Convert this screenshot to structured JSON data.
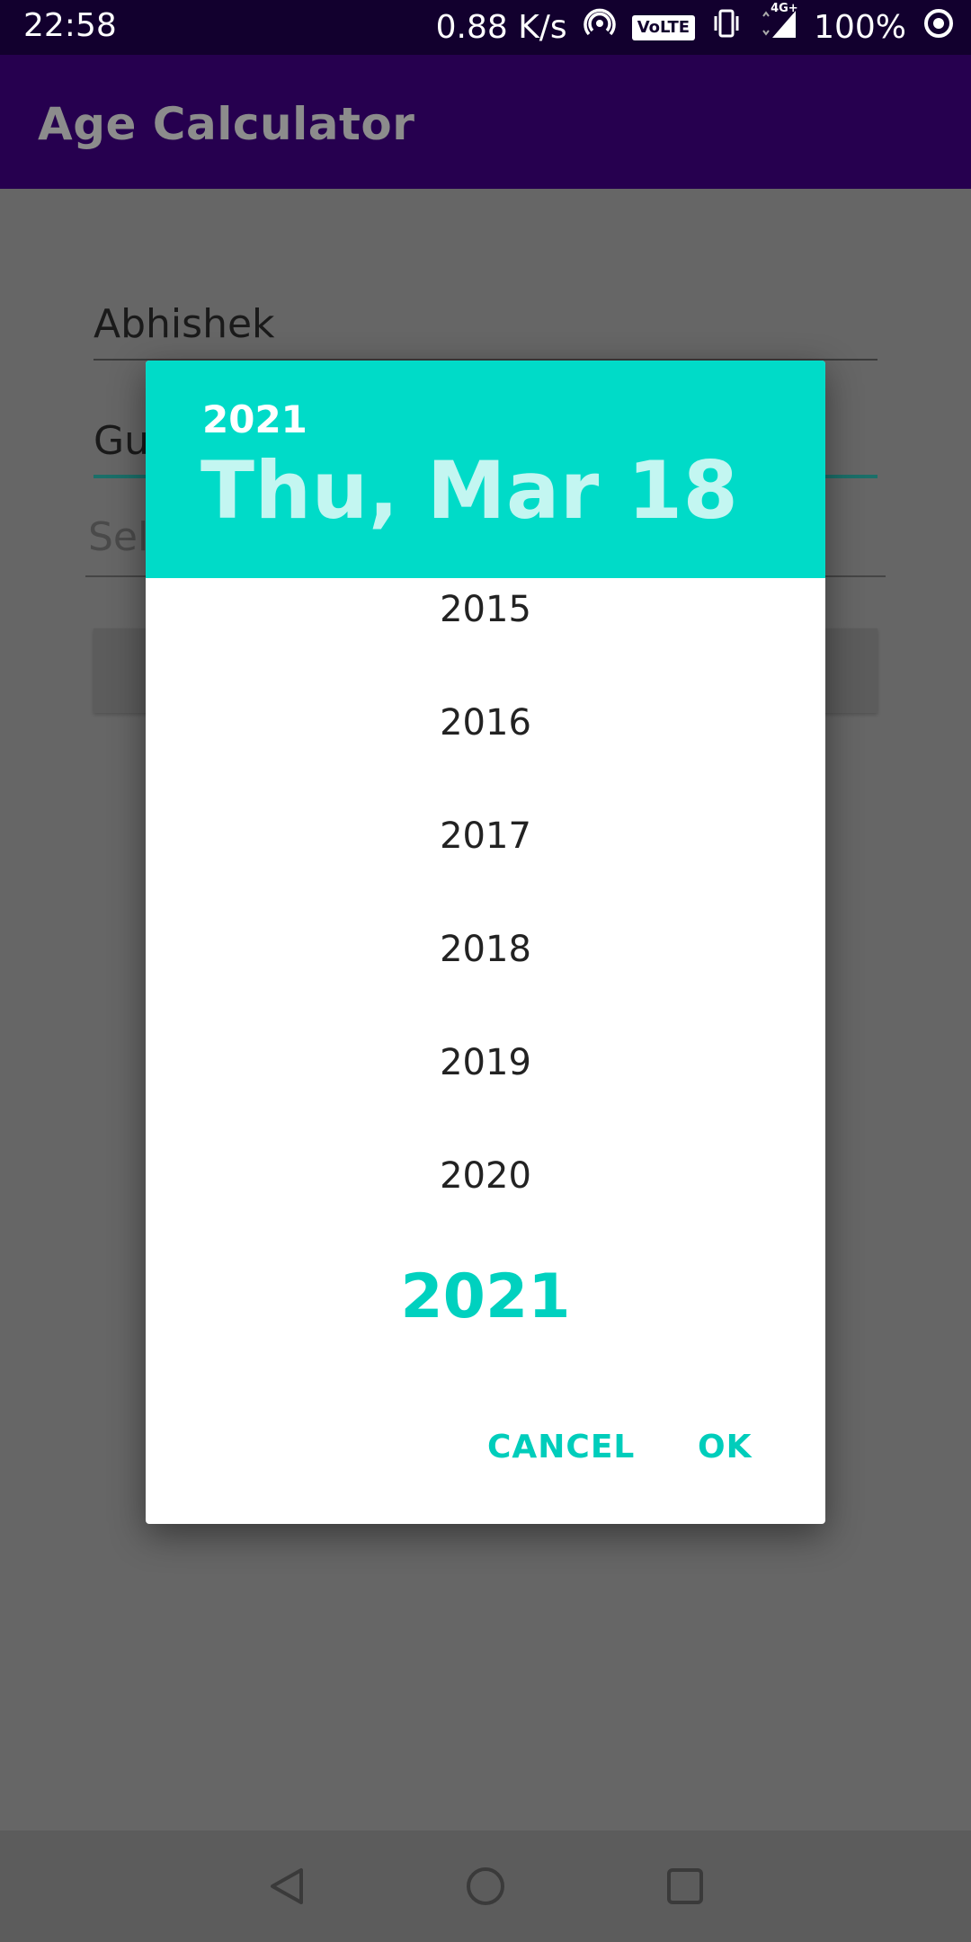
{
  "status_bar": {
    "time": "22:58",
    "network_speed": "0.88 K/s",
    "volte_label": "VoLTE",
    "network_type": "4G+",
    "battery": "100%"
  },
  "app_bar": {
    "title": "Age Calculator"
  },
  "form": {
    "name_value": "Abhishek",
    "surname_value": "Gu",
    "date_placeholder": "Sel"
  },
  "dialog": {
    "header_year": "2021",
    "header_date": "Thu, Mar 18",
    "years": [
      "2015",
      "2016",
      "2017",
      "2018",
      "2019",
      "2020"
    ],
    "selected_year": "2021",
    "cancel_label": "CANCEL",
    "ok_label": "OK"
  },
  "colors": {
    "accent": "#00dbc8",
    "app_bar": "#26004f",
    "status_bar": "#12002e"
  },
  "icons": {
    "hotspot": "hotspot-icon",
    "vibrate": "vibrate-icon",
    "signal": "signal-icon",
    "status_dot": "notification-dot-icon",
    "back": "back-icon",
    "home": "home-icon",
    "recents": "recents-icon"
  }
}
